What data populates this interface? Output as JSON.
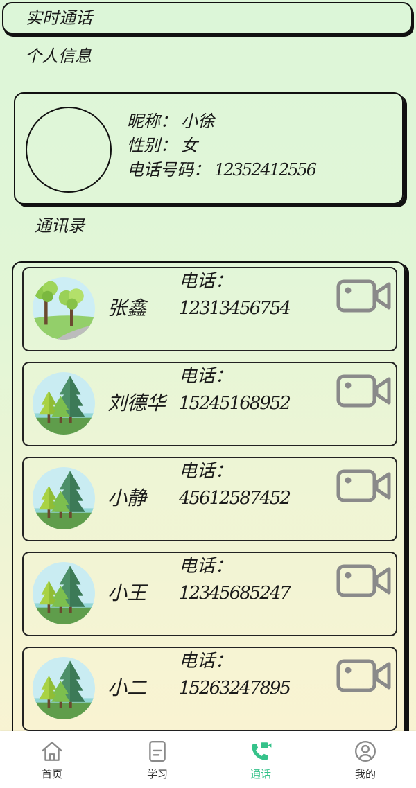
{
  "header": {
    "title": "实时通话"
  },
  "profile": {
    "section_title": "个人信息",
    "nickname_label": "昵称：",
    "nickname": "小徐",
    "gender_label": "性别：",
    "gender": "女",
    "phone_label": "电话号码：",
    "phone": "12352412556"
  },
  "contacts": {
    "section_title": "通讯录",
    "phone_label": "电话：",
    "call_icon": "video-call-icon",
    "items": [
      {
        "name": "张鑫",
        "phone": "12313456754",
        "avatar": "round-trees-avatar"
      },
      {
        "name": "刘德华",
        "phone": "15245168952",
        "avatar": "pine-trees-avatar"
      },
      {
        "name": "小静",
        "phone": "45612587452",
        "avatar": "pine-trees-avatar"
      },
      {
        "name": "小王",
        "phone": "12345685247",
        "avatar": "pine-trees-avatar"
      },
      {
        "name": "小二",
        "phone": "15263247895",
        "avatar": "pine-trees-avatar"
      }
    ]
  },
  "nav": {
    "items": [
      {
        "label": "首页",
        "icon": "home-icon",
        "active": false
      },
      {
        "label": "学习",
        "icon": "document-icon",
        "active": false
      },
      {
        "label": "通话",
        "icon": "phone-call-icon",
        "active": true
      },
      {
        "label": "我的",
        "icon": "user-icon",
        "active": false
      }
    ]
  },
  "colors": {
    "background_top": "#ddf6d9",
    "background_bottom": "#fbf3d2",
    "border": "#111111",
    "icon_gray": "#8a8a8a",
    "active": "#35c28a"
  }
}
